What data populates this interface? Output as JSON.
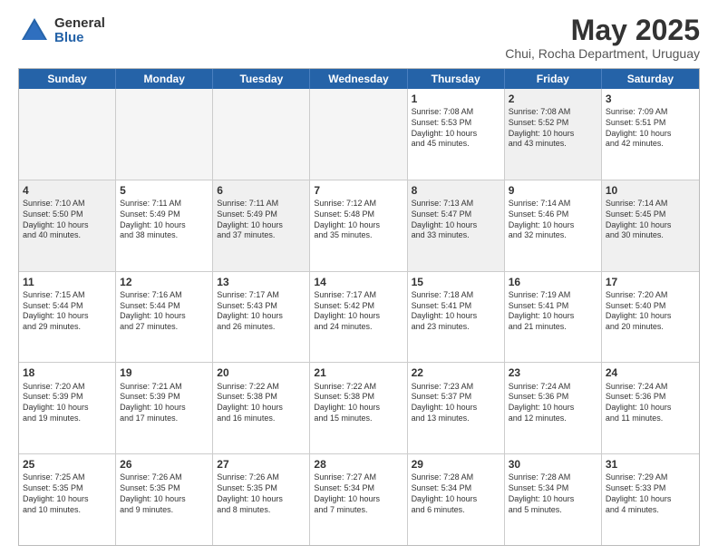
{
  "logo": {
    "general": "General",
    "blue": "Blue"
  },
  "header": {
    "month": "May 2025",
    "location": "Chui, Rocha Department, Uruguay"
  },
  "weekdays": [
    "Sunday",
    "Monday",
    "Tuesday",
    "Wednesday",
    "Thursday",
    "Friday",
    "Saturday"
  ],
  "rows": [
    [
      {
        "day": "",
        "info": "",
        "empty": true
      },
      {
        "day": "",
        "info": "",
        "empty": true
      },
      {
        "day": "",
        "info": "",
        "empty": true
      },
      {
        "day": "",
        "info": "",
        "empty": true
      },
      {
        "day": "1",
        "info": "Sunrise: 7:08 AM\nSunset: 5:53 PM\nDaylight: 10 hours\nand 45 minutes.",
        "empty": false
      },
      {
        "day": "2",
        "info": "Sunrise: 7:08 AM\nSunset: 5:52 PM\nDaylight: 10 hours\nand 43 minutes.",
        "empty": false,
        "shaded": true
      },
      {
        "day": "3",
        "info": "Sunrise: 7:09 AM\nSunset: 5:51 PM\nDaylight: 10 hours\nand 42 minutes.",
        "empty": false
      }
    ],
    [
      {
        "day": "4",
        "info": "Sunrise: 7:10 AM\nSunset: 5:50 PM\nDaylight: 10 hours\nand 40 minutes.",
        "empty": false,
        "shaded": true
      },
      {
        "day": "5",
        "info": "Sunrise: 7:11 AM\nSunset: 5:49 PM\nDaylight: 10 hours\nand 38 minutes.",
        "empty": false
      },
      {
        "day": "6",
        "info": "Sunrise: 7:11 AM\nSunset: 5:49 PM\nDaylight: 10 hours\nand 37 minutes.",
        "empty": false,
        "shaded": true
      },
      {
        "day": "7",
        "info": "Sunrise: 7:12 AM\nSunset: 5:48 PM\nDaylight: 10 hours\nand 35 minutes.",
        "empty": false
      },
      {
        "day": "8",
        "info": "Sunrise: 7:13 AM\nSunset: 5:47 PM\nDaylight: 10 hours\nand 33 minutes.",
        "empty": false,
        "shaded": true
      },
      {
        "day": "9",
        "info": "Sunrise: 7:14 AM\nSunset: 5:46 PM\nDaylight: 10 hours\nand 32 minutes.",
        "empty": false
      },
      {
        "day": "10",
        "info": "Sunrise: 7:14 AM\nSunset: 5:45 PM\nDaylight: 10 hours\nand 30 minutes.",
        "empty": false,
        "shaded": true
      }
    ],
    [
      {
        "day": "11",
        "info": "Sunrise: 7:15 AM\nSunset: 5:44 PM\nDaylight: 10 hours\nand 29 minutes.",
        "empty": false
      },
      {
        "day": "12",
        "info": "Sunrise: 7:16 AM\nSunset: 5:44 PM\nDaylight: 10 hours\nand 27 minutes.",
        "empty": false
      },
      {
        "day": "13",
        "info": "Sunrise: 7:17 AM\nSunset: 5:43 PM\nDaylight: 10 hours\nand 26 minutes.",
        "empty": false
      },
      {
        "day": "14",
        "info": "Sunrise: 7:17 AM\nSunset: 5:42 PM\nDaylight: 10 hours\nand 24 minutes.",
        "empty": false
      },
      {
        "day": "15",
        "info": "Sunrise: 7:18 AM\nSunset: 5:41 PM\nDaylight: 10 hours\nand 23 minutes.",
        "empty": false
      },
      {
        "day": "16",
        "info": "Sunrise: 7:19 AM\nSunset: 5:41 PM\nDaylight: 10 hours\nand 21 minutes.",
        "empty": false
      },
      {
        "day": "17",
        "info": "Sunrise: 7:20 AM\nSunset: 5:40 PM\nDaylight: 10 hours\nand 20 minutes.",
        "empty": false
      }
    ],
    [
      {
        "day": "18",
        "info": "Sunrise: 7:20 AM\nSunset: 5:39 PM\nDaylight: 10 hours\nand 19 minutes.",
        "empty": false
      },
      {
        "day": "19",
        "info": "Sunrise: 7:21 AM\nSunset: 5:39 PM\nDaylight: 10 hours\nand 17 minutes.",
        "empty": false
      },
      {
        "day": "20",
        "info": "Sunrise: 7:22 AM\nSunset: 5:38 PM\nDaylight: 10 hours\nand 16 minutes.",
        "empty": false
      },
      {
        "day": "21",
        "info": "Sunrise: 7:22 AM\nSunset: 5:38 PM\nDaylight: 10 hours\nand 15 minutes.",
        "empty": false
      },
      {
        "day": "22",
        "info": "Sunrise: 7:23 AM\nSunset: 5:37 PM\nDaylight: 10 hours\nand 13 minutes.",
        "empty": false
      },
      {
        "day": "23",
        "info": "Sunrise: 7:24 AM\nSunset: 5:36 PM\nDaylight: 10 hours\nand 12 minutes.",
        "empty": false
      },
      {
        "day": "24",
        "info": "Sunrise: 7:24 AM\nSunset: 5:36 PM\nDaylight: 10 hours\nand 11 minutes.",
        "empty": false
      }
    ],
    [
      {
        "day": "25",
        "info": "Sunrise: 7:25 AM\nSunset: 5:35 PM\nDaylight: 10 hours\nand 10 minutes.",
        "empty": false
      },
      {
        "day": "26",
        "info": "Sunrise: 7:26 AM\nSunset: 5:35 PM\nDaylight: 10 hours\nand 9 minutes.",
        "empty": false
      },
      {
        "day": "27",
        "info": "Sunrise: 7:26 AM\nSunset: 5:35 PM\nDaylight: 10 hours\nand 8 minutes.",
        "empty": false
      },
      {
        "day": "28",
        "info": "Sunrise: 7:27 AM\nSunset: 5:34 PM\nDaylight: 10 hours\nand 7 minutes.",
        "empty": false
      },
      {
        "day": "29",
        "info": "Sunrise: 7:28 AM\nSunset: 5:34 PM\nDaylight: 10 hours\nand 6 minutes.",
        "empty": false
      },
      {
        "day": "30",
        "info": "Sunrise: 7:28 AM\nSunset: 5:34 PM\nDaylight: 10 hours\nand 5 minutes.",
        "empty": false
      },
      {
        "day": "31",
        "info": "Sunrise: 7:29 AM\nSunset: 5:33 PM\nDaylight: 10 hours\nand 4 minutes.",
        "empty": false
      }
    ]
  ]
}
